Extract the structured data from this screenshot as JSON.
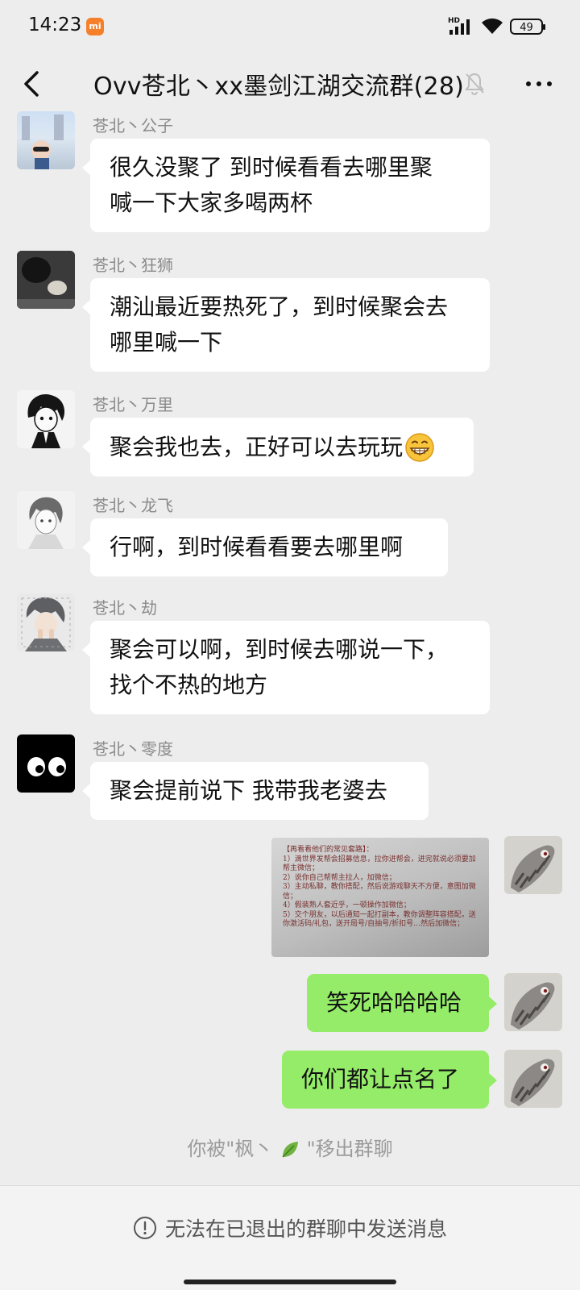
{
  "status_bar": {
    "time": "14:23",
    "brand_badge": "mi",
    "network": "HD",
    "battery": "49",
    "accent": "#f57f2a"
  },
  "header": {
    "title": "Ovv苍北丶xx墨剑江湖交流群(28)",
    "back_icon": "chevron-left-icon",
    "mute_icon": "bell-off-icon",
    "more_icon": "more-dots-icon"
  },
  "messages": [
    {
      "sender": "苍北丶公子",
      "text": "很久没聚了 到时候看看去哪里聚\n喊一下大家多喝两杯",
      "side": "left"
    },
    {
      "sender": "苍北丶狂狮",
      "text": "潮汕最近要热死了，到时候聚会去\n哪里喊一下",
      "side": "left"
    },
    {
      "sender": "苍北丶万里",
      "text": "聚会我也去，正好可以去玩玩",
      "emoji": "grinning-face-icon",
      "side": "left"
    },
    {
      "sender": "苍北丶龙飞",
      "text": "行啊，到时候看看要去哪里啊",
      "side": "left"
    },
    {
      "sender": "苍北丶劫",
      "text": "聚会可以啊，到时候去哪说一下，\n找个不热的地方",
      "side": "left"
    },
    {
      "sender": "苍北丶零度",
      "text": "聚会提前说下 我带我老婆去",
      "side": "left"
    },
    {
      "type": "image",
      "side": "right",
      "image_text": "【再看看他们的常见套路】：\n1）滴世界发帮会招募信息，拉你进帮会，进完就说必须要加帮主微信；\n2）说你自己帮帮主拉人，加微信；\n3）主动私聊，教你搭配，然后说游戏聊天不方便，意图加微信；\n4）假装熟人套近乎，一顿操作加微信；\n5）交个朋友，以后通知一起打副本，教你调整阵容搭配，送你激活码/礼包，送开局号/自抽号/折扣号…然后加微信；"
    },
    {
      "text": "笑死哈哈哈哈",
      "side": "right"
    },
    {
      "text": "你们都让点名了",
      "side": "right"
    }
  ],
  "system_notice": {
    "before": "你被\"枫丶",
    "after": "\"移出群聊",
    "icon": "leaf-icon"
  },
  "footer": {
    "text": "无法在已退出的群聊中发送消息",
    "icon": "info-circle-icon"
  },
  "colors": {
    "background": "#ededed",
    "bubble_left": "#ffffff",
    "bubble_right": "#95ec69",
    "sender_name": "#8a8a8a"
  }
}
